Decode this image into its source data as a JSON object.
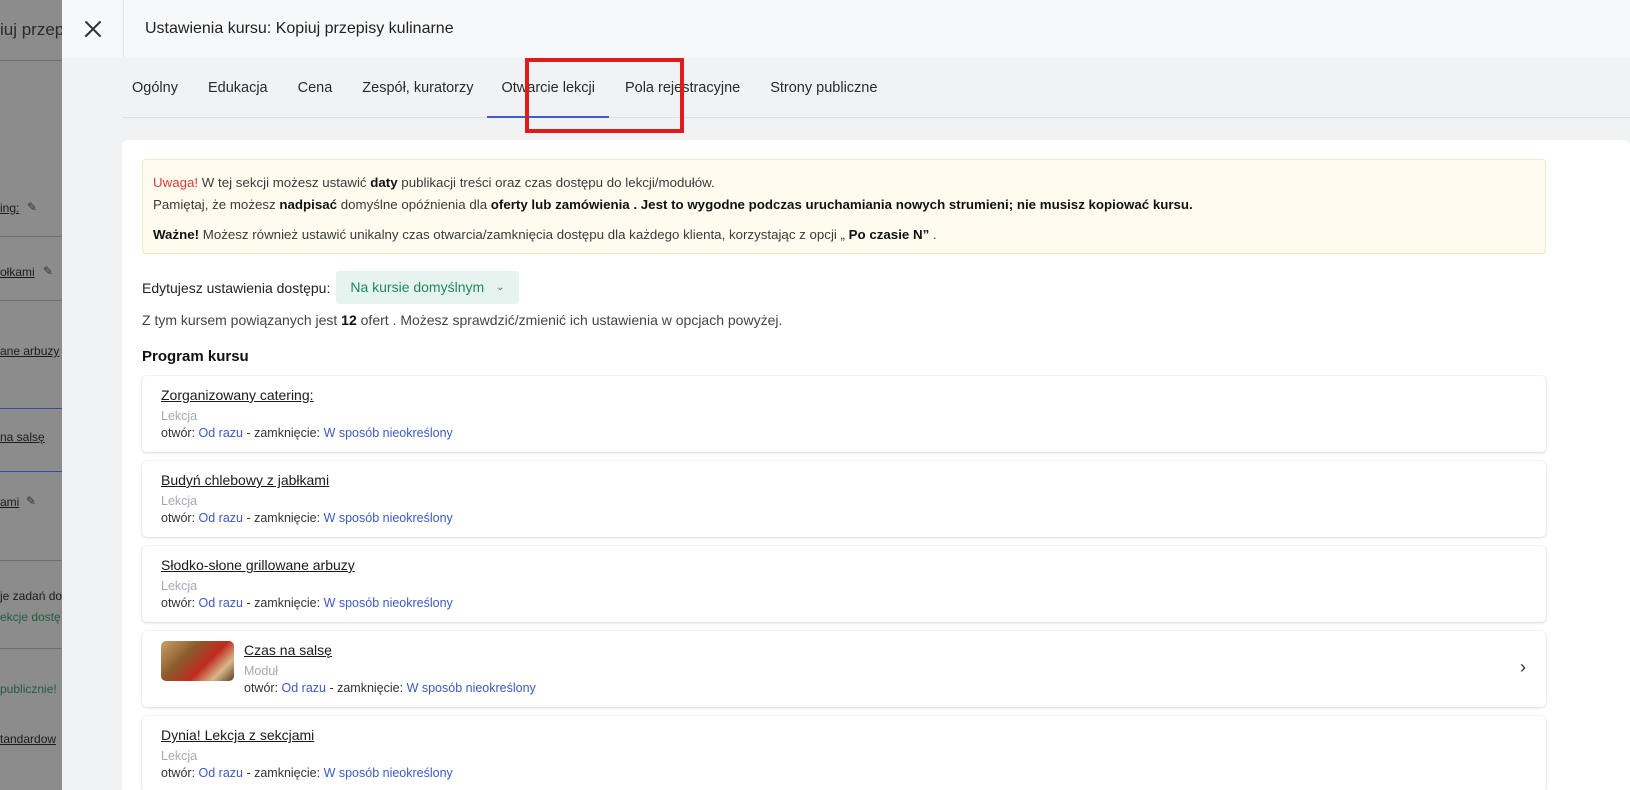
{
  "background": {
    "title": "iuj przep",
    "items": [
      {
        "label": "ing:",
        "style": "link"
      },
      {
        "label": "ołkami",
        "style": "link"
      },
      {
        "label": "ane arbuzy",
        "style": "link"
      },
      {
        "label": "na salsę",
        "style": "link"
      },
      {
        "label": "ami",
        "style": "link"
      },
      {
        "label": "je zadań do",
        "style": "plain"
      },
      {
        "label": "ekcje dostę",
        "style": "green"
      },
      {
        "label": "publicznie!",
        "style": "green"
      },
      {
        "label": "tandardow",
        "style": "link"
      }
    ]
  },
  "drawer": {
    "title": "Ustawienia kursu: Kopiuj przepisy kulinarne",
    "close_icon": "close-icon"
  },
  "tabs": [
    {
      "label": "Ogólny",
      "active": false
    },
    {
      "label": "Edukacja",
      "active": false
    },
    {
      "label": "Cena",
      "active": false
    },
    {
      "label": "Zespół, kuratorzy",
      "active": false
    },
    {
      "label": "Otwarcie lekcji",
      "active": true
    },
    {
      "label": "Pola rejestracyjne",
      "active": false
    },
    {
      "label": "Strony publiczne",
      "active": false
    }
  ],
  "notice": {
    "warn_label": "Uwaga!",
    "line1_a": " W tej sekcji możesz ustawić ",
    "line1_b": "daty",
    "line1_c": " publikacji treści oraz czas dostępu do lekcji/modułów.",
    "line2_a": "Pamiętaj, że możesz ",
    "line2_b": "nadpisać",
    "line2_c": " domyślne opóźnienia dla ",
    "line2_d": "oferty lub zamówienia . Jest to wygodne podczas uruchamiania nowych strumieni; nie musisz kopiować kursu.",
    "line3_a": "Ważne!",
    "line3_b": " Możesz również ustawić unikalny czas otwarcia/zamknięcia dostępu dla każdego klienta, korzystając z opcji „ ",
    "line3_c": "Po czasie N”",
    "line3_d": " ."
  },
  "access": {
    "label": "Edytujesz ustawienia dostępu:",
    "selected": "Na kursie domyślnym",
    "chevron_icon": "chevron-down-icon"
  },
  "offers": {
    "prefix": "Z tym kursem powiązanych jest ",
    "count": "12",
    "suffix": " ofert . Możesz sprawdzić/zmienić ich ustawienia w opcjach powyżej."
  },
  "program": {
    "title": "Program kursu",
    "open_label": "otwór: ",
    "close_label": "zamknięcie: ",
    "separator": " - ",
    "items": [
      {
        "title": "Zorganizowany catering:",
        "type": "Lekcja",
        "open": "Od razu",
        "close": "W sposób nieokreślony"
      },
      {
        "title": "Budyń chlebowy z jabłkami",
        "type": "Lekcja",
        "open": "Od razu",
        "close": "W sposób nieokreślony"
      },
      {
        "title": "Słodko-słone grillowane arbuzy",
        "type": "Lekcja",
        "open": "Od razu",
        "close": "W sposób nieokreślony"
      },
      {
        "title": "Czas na salsę",
        "type": "Moduł",
        "open": "Od razu",
        "close": "W sposób nieokreślony"
      },
      {
        "title": "Dynia! Lekcja z sekcjami",
        "type": "Lekcja",
        "open": "Od razu",
        "close": "W sposób nieokreślony"
      }
    ]
  },
  "colors": {
    "highlight": "#e01b1b",
    "accent": "#3c5bd4",
    "green": "#1f8a5b",
    "warn": "#d83a3a"
  }
}
